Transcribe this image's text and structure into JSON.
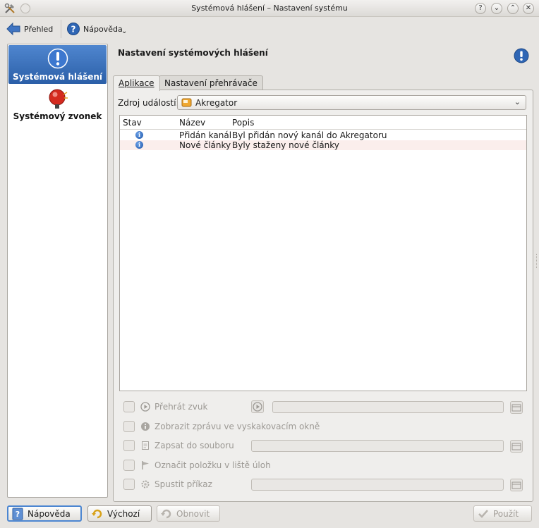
{
  "window": {
    "title": "Systémová hlášení – Nastavení systému"
  },
  "toolbar": {
    "back_label": "Přehled",
    "help_label": "Nápověda"
  },
  "sidebar": {
    "items": [
      {
        "label": "Systémová hlášení",
        "active": true,
        "icon": "info-exclamation-icon"
      },
      {
        "label": "Systémový zvonek",
        "active": false,
        "icon": "bell-icon"
      }
    ]
  },
  "main": {
    "heading": "Nastavení systémových hlášení",
    "tabs": [
      {
        "label": "Aplikace",
        "active": true
      },
      {
        "label": "Nastavení přehrávače",
        "active": false
      }
    ],
    "source_label": "Zdroj událostí:",
    "source_value": "Akregator",
    "table": {
      "headers": [
        "Stav",
        "Název",
        "Popis"
      ],
      "rows": [
        {
          "name": "Přidán kanál",
          "description": "Byl přidán nový kanál do Akregatoru"
        },
        {
          "name": "Nové články",
          "description": "Byly staženy nové články"
        }
      ]
    },
    "options": [
      {
        "label": "Přehrát zvuk",
        "icon": "play-icon"
      },
      {
        "label": "Zobrazit zprávu ve vyskakovacím okně",
        "icon": "info-icon"
      },
      {
        "label": "Zapsat do souboru",
        "icon": "document-icon"
      },
      {
        "label": "Označit položku v liště úloh",
        "icon": "flag-icon"
      },
      {
        "label": "Spustit příkaz",
        "icon": "gear-icon"
      }
    ]
  },
  "buttons": {
    "help": "Nápověda",
    "defaults": "Výchozí",
    "reset": "Obnovit",
    "apply": "Použít"
  },
  "colors": {
    "accent": "#2b5fa8",
    "selection": "#4f86cf",
    "alt_row": "#fbeeec"
  }
}
